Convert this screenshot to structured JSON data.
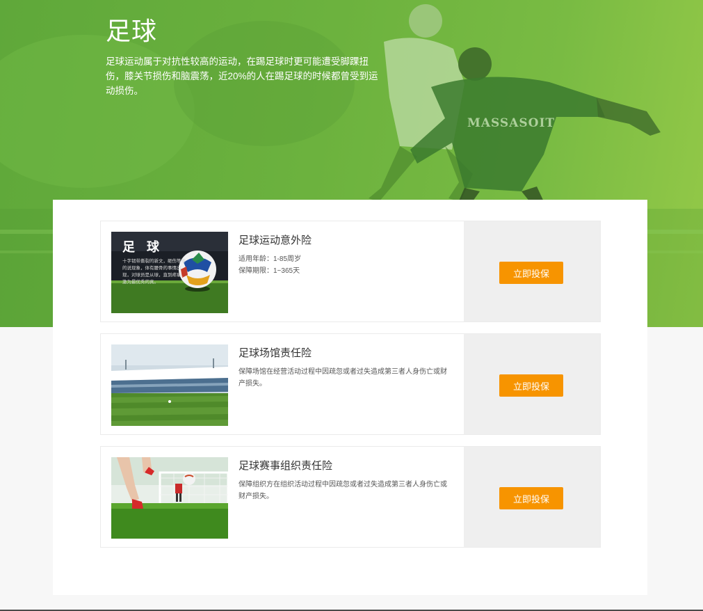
{
  "hero": {
    "title": "足球",
    "description": "足球运动属于对抗性较高的运动，在踢足球时更可能遭受脚踝扭伤，膝关节损伤和脑震荡，近20%的人在踢足球的时候都曾受到运动损伤。",
    "jersey_text": "MASSASOIT"
  },
  "products": [
    {
      "title": "足球运动意外险",
      "meta": [
        "适用年龄：1-85周岁",
        "保障期限：1~365天"
      ],
      "thumb_title": "足 球",
      "thumb_text": "十字韧带撕裂的新文，砸伤等等的说现象，体有腰骨的事情出现，对球员是从球，直到疼痛、激为最优秀的真。",
      "button": "立即投保"
    },
    {
      "title": "足球场馆责任险",
      "description": "保障场馆在经营活动过程中因疏忽或者过失造成第三者人身伤亡或财产损失。",
      "button": "立即投保"
    },
    {
      "title": "足球赛事组织责任险",
      "description": "保障组织方在组织活动过程中因疏忽或者过失造成第三者人身伤亡或财产损失。",
      "button": "立即投保"
    }
  ],
  "colors": {
    "hero_green": "#6cb23e",
    "button_orange": "#f79400",
    "side_gray": "#efefef"
  }
}
